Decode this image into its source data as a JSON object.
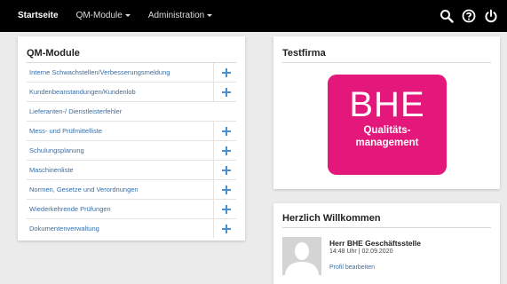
{
  "navbar": {
    "home": "Startseite",
    "qm_modules": "QM-Module",
    "administration": "Administration",
    "icons": [
      "search-icon",
      "help-icon",
      "power-icon"
    ]
  },
  "qm_panel": {
    "title": "QM-Module",
    "items": [
      {
        "label": "Interne Schwachstellen/Verbesserungsmeldung",
        "addable": true
      },
      {
        "label": "Kundenbeanstandungen/Kundenlob",
        "addable": true
      },
      {
        "label": "Lieferanten-/ Dienstleisterfehler",
        "addable": false
      },
      {
        "label": "Mess- und Prüfmittelliste",
        "addable": true
      },
      {
        "label": "Schulungsplanung",
        "addable": true
      },
      {
        "label": "Maschinenliste",
        "addable": true
      },
      {
        "label": "Normen, Gesetze und Verordnungen",
        "addable": true
      },
      {
        "label": "Wiederkehrende Prüfungen",
        "addable": true
      },
      {
        "label": "Dokumentenverwaltung",
        "addable": true
      }
    ]
  },
  "firm_panel": {
    "title": "Testfirma",
    "logo": {
      "big": "BHE",
      "line1": "Qualitäts-",
      "line2": "management"
    }
  },
  "welcome_panel": {
    "title": "Herzlich Willkommen",
    "user_name": "Herr BHE Geschäftsstelle",
    "login_time": "14:48 Uhr | 02.09.2020",
    "profile_link": "Profil bearbeiten"
  },
  "colors": {
    "navbar": "#000000",
    "link": "#3a6ea5",
    "add_icon": "#4a8fd1",
    "logo": "#e3187a"
  }
}
